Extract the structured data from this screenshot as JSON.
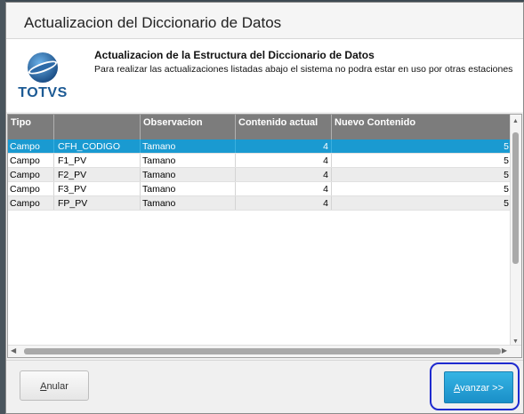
{
  "window": {
    "title": "Actualizacion del Diccionario de Datos"
  },
  "header": {
    "title": "Actualizacion de la Estructura del Diccionario de Datos",
    "subtitle": "Para realizar las actualizaciones listadas abajo el sistema no podra estar en uso por otras estaciones",
    "logo_text": "TOTVS"
  },
  "table": {
    "columns": [
      "Tipo",
      "",
      "Observacion",
      "Contenido actual",
      "Nuevo Contenido"
    ],
    "rows": [
      {
        "tipo": "Campo",
        "campo": "CFH_CODIGO",
        "obs": "Tamano",
        "actual": "4",
        "nuevo": "5",
        "selected": true
      },
      {
        "tipo": "Campo",
        "campo": "F1_PV",
        "obs": "Tamano",
        "actual": "4",
        "nuevo": "5"
      },
      {
        "tipo": "Campo",
        "campo": "F2_PV",
        "obs": "Tamano",
        "actual": "4",
        "nuevo": "5"
      },
      {
        "tipo": "Campo",
        "campo": "F3_PV",
        "obs": "Tamano",
        "actual": "4",
        "nuevo": "5"
      },
      {
        "tipo": "Campo",
        "campo": "FP_PV",
        "obs": "Tamano",
        "actual": "4",
        "nuevo": "5"
      }
    ]
  },
  "buttons": {
    "anular_prefix": "A",
    "anular_rest": "nular",
    "avanzar_prefix": "A",
    "avanzar_rest": "vanzar >>"
  },
  "colors": {
    "accent": "#1a9ad1",
    "focus_ring": "#1f2bcf",
    "header_bg": "#7c7c7c"
  },
  "icons": {
    "logo": "totvs-logo",
    "scroll_up": "triangle-up",
    "scroll_down": "triangle-down",
    "scroll_left": "triangle-left",
    "scroll_right": "triangle-right"
  }
}
